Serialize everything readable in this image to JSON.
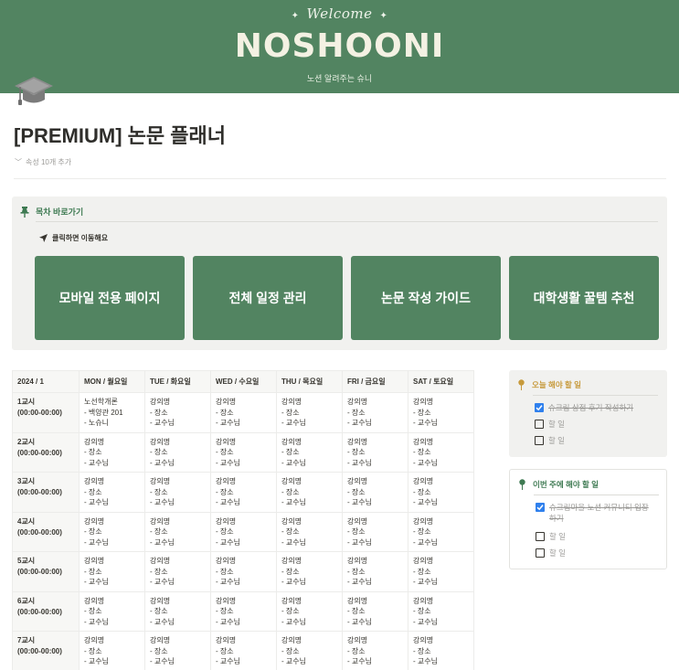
{
  "banner": {
    "welcome": "Welcome",
    "brand": "NOSHOONI",
    "tagline": "노션 알려주는 슈니"
  },
  "page": {
    "icon": "graduation-cap-icon",
    "title": "[PREMIUM] 논문 플래너",
    "properties_label": "속성 10개 추가"
  },
  "toc": {
    "heading": "목차 바로가기",
    "subheading": "클릭하면 이동해요",
    "tiles": [
      "모바일 전용 페이지",
      "전체 일정 관리",
      "논문 작성 가이드",
      "대학생활 꿀템 추천"
    ]
  },
  "timetable": {
    "headers": [
      "2024 / 1",
      "MON / 월요일",
      "TUE / 화요일",
      "WED / 수요일",
      "THU / 목요일",
      "FRI / 금요일",
      "SAT / 토요일"
    ],
    "rows": [
      {
        "period": "1교시",
        "time": "(00:00-00:00)",
        "cells": [
          [
            "노선학개론",
            "- 백양관 201",
            "- 노슈니"
          ],
          [
            "강의명",
            "- 장소",
            "- 교수님"
          ],
          [
            "강의명",
            "- 장소",
            "- 교수님"
          ],
          [
            "강의명",
            "- 장소",
            "- 교수님"
          ],
          [
            "강의명",
            "- 장소",
            "- 교수님"
          ],
          [
            "강의명",
            "- 장소",
            "- 교수님"
          ]
        ]
      },
      {
        "period": "2교시",
        "time": "(00:00-00:00)",
        "cells": [
          [
            "강의명",
            "- 장소",
            "- 교수님"
          ],
          [
            "강의명",
            "- 장소",
            "- 교수님"
          ],
          [
            "강의명",
            "- 장소",
            "- 교수님"
          ],
          [
            "강의명",
            "- 장소",
            "- 교수님"
          ],
          [
            "강의명",
            "- 장소",
            "- 교수님"
          ],
          [
            "강의명",
            "- 장소",
            "- 교수님"
          ]
        ]
      },
      {
        "period": "3교시",
        "time": "(00:00-00:00)",
        "cells": [
          [
            "강의명",
            "- 장소",
            "- 교수님"
          ],
          [
            "강의명",
            "- 장소",
            "- 교수님"
          ],
          [
            "강의명",
            "- 장소",
            "- 교수님"
          ],
          [
            "강의명",
            "- 장소",
            "- 교수님"
          ],
          [
            "강의명",
            "- 장소",
            "- 교수님"
          ],
          [
            "강의명",
            "- 장소",
            "- 교수님"
          ]
        ]
      },
      {
        "period": "4교시",
        "time": "(00:00-00:00)",
        "cells": [
          [
            "강의명",
            "- 장소",
            "- 교수님"
          ],
          [
            "강의명",
            "- 장소",
            "- 교수님"
          ],
          [
            "강의명",
            "- 장소",
            "- 교수님"
          ],
          [
            "강의명",
            "- 장소",
            "- 교수님"
          ],
          [
            "강의명",
            "- 장소",
            "- 교수님"
          ],
          [
            "강의명",
            "- 장소",
            "- 교수님"
          ]
        ]
      },
      {
        "period": "5교시",
        "time": "(00:00-00:00)",
        "cells": [
          [
            "강의명",
            "- 장소",
            "- 교수님"
          ],
          [
            "강의명",
            "- 장소",
            "- 교수님"
          ],
          [
            "강의명",
            "- 장소",
            "- 교수님"
          ],
          [
            "강의명",
            "- 장소",
            "- 교수님"
          ],
          [
            "강의명",
            "- 장소",
            "- 교수님"
          ],
          [
            "강의명",
            "- 장소",
            "- 교수님"
          ]
        ]
      },
      {
        "period": "6교시",
        "time": "(00:00-00:00)",
        "cells": [
          [
            "강의명",
            "- 장소",
            "- 교수님"
          ],
          [
            "강의명",
            "- 장소",
            "- 교수님"
          ],
          [
            "강의명",
            "- 장소",
            "- 교수님"
          ],
          [
            "강의명",
            "- 장소",
            "- 교수님"
          ],
          [
            "강의명",
            "- 장소",
            "- 교수님"
          ],
          [
            "강의명",
            "- 장소",
            "- 교수님"
          ]
        ]
      },
      {
        "period": "7교시",
        "time": "(00:00-00:00)",
        "cells": [
          [
            "강의명",
            "- 장소",
            "- 교수님"
          ],
          [
            "강의명",
            "- 장소",
            "- 교수님"
          ],
          [
            "강의명",
            "- 장소",
            "- 교수님"
          ],
          [
            "강의명",
            "- 장소",
            "- 교수님"
          ],
          [
            "강의명",
            "- 장소",
            "- 교수님"
          ],
          [
            "강의명",
            "- 장소",
            "- 교수님"
          ]
        ]
      }
    ]
  },
  "todo_today": {
    "heading": "오늘 해야 할 일",
    "items": [
      {
        "label": "슈크림 상점 후기 작성하기",
        "checked": true
      },
      {
        "label": "할 일",
        "checked": false
      },
      {
        "label": "할 일",
        "checked": false
      }
    ]
  },
  "todo_week": {
    "heading": "이번 주에 해야 할 일",
    "items": [
      {
        "label": "슈크림마을 노션 커뮤니티 입장하기",
        "checked": true
      },
      {
        "label": "할 일",
        "checked": false
      },
      {
        "label": "할 일",
        "checked": false
      }
    ]
  },
  "colors": {
    "brand_green": "#528461",
    "callout_bg": "#f1f1ef",
    "checkbox_blue": "#2f80ed",
    "today_accent": "#c79a3b",
    "week_accent": "#3e7a52"
  }
}
